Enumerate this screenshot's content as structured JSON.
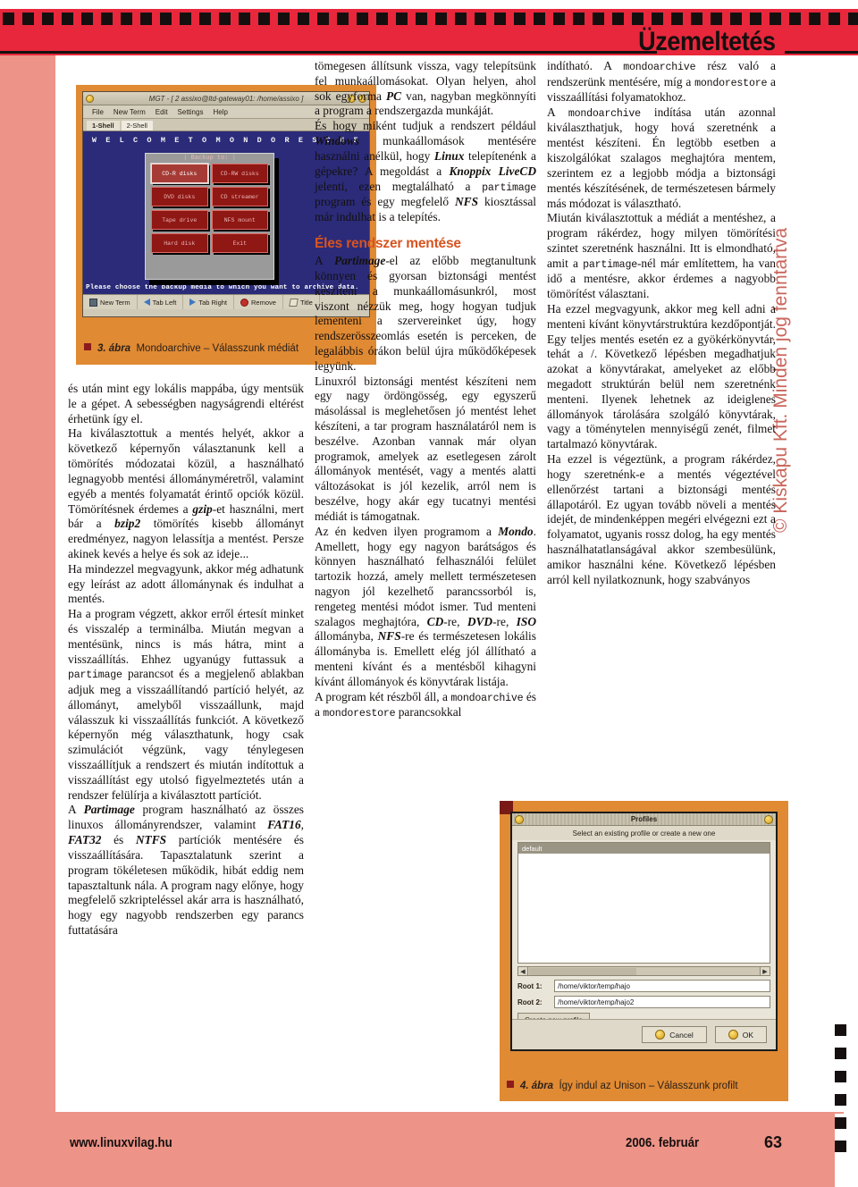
{
  "header": {
    "section_title": "Üzemeltetés"
  },
  "copyright": "© Kiskapu Kft. Minden jog fenntartva",
  "figure3": {
    "caption_number": "3. ábra",
    "caption_text": "Mondoarchive – Válasszunk médiát",
    "window": {
      "title": "MGT - [ 2 assixo@ltd-gateway01: /home/assixo ]",
      "menu": [
        "File",
        "New Term",
        "Edit",
        "Settings",
        "Help"
      ],
      "tabs": [
        "1-Shell",
        "2-Shell"
      ],
      "welcome": "W E L C O M E   T O   M O N D O   R E S C U E",
      "dialog_title": "| Backup to: |",
      "buttons": [
        "CD-R disks",
        "CD-RW disks",
        "DVD disks",
        "CD streamer",
        "Tape drive",
        "NFS mount",
        "Hard disk",
        "Exit"
      ],
      "selected_button": "CD-R disks",
      "status": "Please choose the backup media to which you want to archive data.",
      "toolbar": [
        "New Term",
        "Tab Left",
        "Tab Right",
        "Remove",
        "Title"
      ],
      "toolbar_icons": [
        "terminal-icon",
        "arrow-left-icon",
        "arrow-right-icon",
        "remove-icon",
        "title-icon"
      ]
    }
  },
  "figure4": {
    "caption_number": "4. ábra",
    "caption_text": "Így indul az Unison – Válasszunk profilt",
    "dialog": {
      "title": "Profiles",
      "subtitle": "Select an existing profile or create a new one",
      "profiles": [
        "default"
      ],
      "selected_profile": "default",
      "root1_label": "Root 1:",
      "root1_value": "/home/viktor/temp/hajo",
      "root2_label": "Root 2:",
      "root2_value": "/home/viktor/temp/hajo2",
      "create_button": "Create new profile",
      "cancel_button": "Cancel",
      "ok_button": "OK"
    }
  },
  "columns": {
    "col1": [
      "és után mint egy lokális mappába, úgy mentsük le a gépet. A sebességben nagyságrendi eltérést érhetünk így el.",
      "Ha kiválasztottuk a mentés helyét, akkor a következő képernyőn választanunk kell a tömörítés módozatai közül, a használható legnagyobb mentési állományméretről, valamint egyéb a mentés folyamatát érintő opciók közül. Tömörítésnek érdemes a ",
      "-et használni, mert bár a ",
      " tömörítés kisebb állományt eredményez, nagyon lelassítja a mentést. Persze akinek kevés a helye és sok az ideje...",
      "Ha mindezzel megvagyunk, akkor még adhatunk egy leírást az adott állománynak és indulhat a mentés.",
      "Ha a program végzett, akkor erről értesít minket és visszalép a terminálba. Miután megvan a mentésünk, nincs is más hátra, mint a visszaállítás. Ehhez ugyanúgy futtassuk a ",
      " parancsot és a megjelenő ablakban adjuk meg a visszaállítandó partíció helyét, az állományt, amelyből visszaállunk, majd válasszuk ki visszaállítás funkciót. A következő képernyőn még választhatunk, hogy csak szimulációt végzünk, vagy ténylegesen visszaállítjuk a rendszert és miután indítottuk a visszaállítást egy utolsó figyelmeztetés után a rendszer felülírja a kiválasztott partíciót.",
      "A ",
      " program használható az összes linuxos állományrendszer, valamint ",
      " partíciók mentésére és visszaállítására. Tapasztalatunk szerint a program tökéletesen működik, hibát eddig nem tapasztaltunk nála. A program nagy előnye, hogy megfelelő szkripteléssel akár arra is használható, hogy egy nagyobb rendszerben egy parancs futtatására"
    ],
    "col1_inline": {
      "gzip": "gzip",
      "bzip2": "bzip2",
      "partimage": "partimage",
      "Partimage": "Partimage",
      "fat16": "FAT16",
      "fat32": "FAT32",
      "ntfs": "NTFS"
    },
    "col2_p1_a": "tömegesen állítsunk vissza, vagy telepítsünk fel munkaállomásokat. Olyan helyen, ahol sok egyforma ",
    "col2_pc": "PC",
    "col2_p1_b": " van, nagyban megkönnyíti a program a rendszergazda munkáját.",
    "col2_p2_a": "És hogy miként tudjuk a rendszert például ",
    "col2_windows": "Windows",
    "col2_p2_b": " munkaállomások mentésére használni anélkül, hogy ",
    "col2_linux": "Linux",
    "col2_p2_c": " telepítenénk a gépekre? A megoldást a ",
    "col2_knoppix": "Knoppix LiveCD",
    "col2_p2_d": " jelenti, ezen megtalálható a ",
    "col2_partimage": "partimage",
    "col2_p2_e": " program és egy megfelelő ",
    "col2_nfs": "NFS",
    "col2_p2_f": " kiosztással már indulhat is a telepítés.",
    "col2_heading": "Éles rendszer mentése",
    "col2_p3_a": "A ",
    "col2_partimage2": "Partimage",
    "col2_p3_b": "-el az előbb megtanultunk könnyen és gyorsan biztonsági mentést készíteni a munkaállomásunkról, most viszont nézzük meg, hogy hogyan tudjuk lementeni a szervereinket úgy, hogy rendszerösszeomlás esetén is perceken, de legalábbis órákon belül újra működőképesek legyünk.",
    "col2_p4": "Linuxról biztonsági mentést készíteni nem egy nagy ördöngösség, egy egyszerű másolással is meglehetősen jó mentést lehet készíteni, a tar program használatáról nem is beszélve. Azonban vannak már olyan programok, amelyek az esetlegesen zárolt állományok mentését, vagy a mentés alatti változásokat is jól kezelik, arról nem is beszélve, hogy akár egy tucatnyi mentési médiát is támogatnak.",
    "col2_p5_a": "Az én kedven ilyen programom a ",
    "col2_mondo": "Mondo",
    "col2_p5_b": ". Amellett, hogy egy nagyon barátságos és könnyen használható felhasználói felület tartozik hozzá, amely mellett természetesen nagyon jól kezelhető parancssorból is, rengeteg mentési módot ismer. Tud menteni szalagos meghajtóra, ",
    "col2_cd": "CD",
    "col2_p5_c": "-re, ",
    "col2_dvd": "DVD",
    "col2_p5_d": "-re, ",
    "col2_iso": "ISO",
    "col2_p5_e": " állományba, ",
    "col2_nfs2": "NFS",
    "col2_p5_f": "-re és természetesen lokális állományba is. Emellett elég jól állítható a menteni kívánt és a mentésből kihagyni kívánt állományok és könyvtárak listája.",
    "col2_p6_a": "A program két részből áll, a ",
    "col2_mondoarchive": "mondoarchive",
    "col2_p6_b": " és a ",
    "col2_mondorestore": "mondorestore",
    "col2_p6_c": " parancsokkal",
    "col3_p1_a": "indítható. A ",
    "col3_mondoarchive": "mondoarchive",
    "col3_p1_b": " rész való a rendszerünk mentésére, míg a ",
    "col3_mondorestore": "mondorestore",
    "col3_p1_c": " a visszaállítási folyamatokhoz.",
    "col3_p2_a": "A ",
    "col3_mondoarchive2": "mondoarchive",
    "col3_p2_b": " indítása után azonnal kiválaszthatjuk, hogy hová szeretnénk a mentést készíteni. Én legtöbb esetben a kiszolgálókat szalagos meghajtóra mentem, szerintem ez a legjobb módja a biztonsági mentés készítésének, de természetesen bármely más módozat is választható.",
    "col3_p3_a": "Miután kiválasztottuk a médiát a mentéshez, a program rákérdez, hogy milyen tömörítési szintet szeretnénk használni. Itt is elmondható, amit a ",
    "col3_partimage": "partimage",
    "col3_p3_b": "-nél már említettem, ha van idő a mentésre, akkor érdemes a nagyobb tömörítést választani.",
    "col3_p4": "Ha ezzel megvagyunk, akkor meg kell adni a menteni kívánt könyvtárstruktúra kezdőpontját. Egy teljes mentés esetén ez a gyökérkönyvtár, tehát a /. Következő lépésben megadhatjuk azokat a könyvtárakat, amelyeket az előbb megadott struktúrán belül nem szeretnénk menteni. Ilyenek lehetnek az ideiglenes állományok tárolására szolgáló könyvtárak, vagy a töménytelen mennyiségű zenét, filmet tartalmazó könyvtárak.",
    "col3_p5": "Ha ezzel is végeztünk, a program rákérdez, hogy szeretnénk-e a mentés végeztével ellenőrzést tartani a biztonsági mentés állapotáról. Ez ugyan tovább növeli a mentés idejét, de mindenképpen megéri elvégezni ezt a folyamatot, ugyanis rossz dolog, ha egy mentés használhatatlanságával akkor szembesülünk, amikor használni kéne. Következő lépésben arról kell nyilatkoznunk, hogy szabványos"
  },
  "footer": {
    "url": "www.linuxvilag.hu",
    "date": "2006. február",
    "page": "63"
  },
  "colors": {
    "header_red": "#e8273c",
    "salmon": "#ed9387",
    "figure_orange": "#e08a33",
    "heading_orange": "#d8531f",
    "copyright_rose": "#c9655b"
  }
}
